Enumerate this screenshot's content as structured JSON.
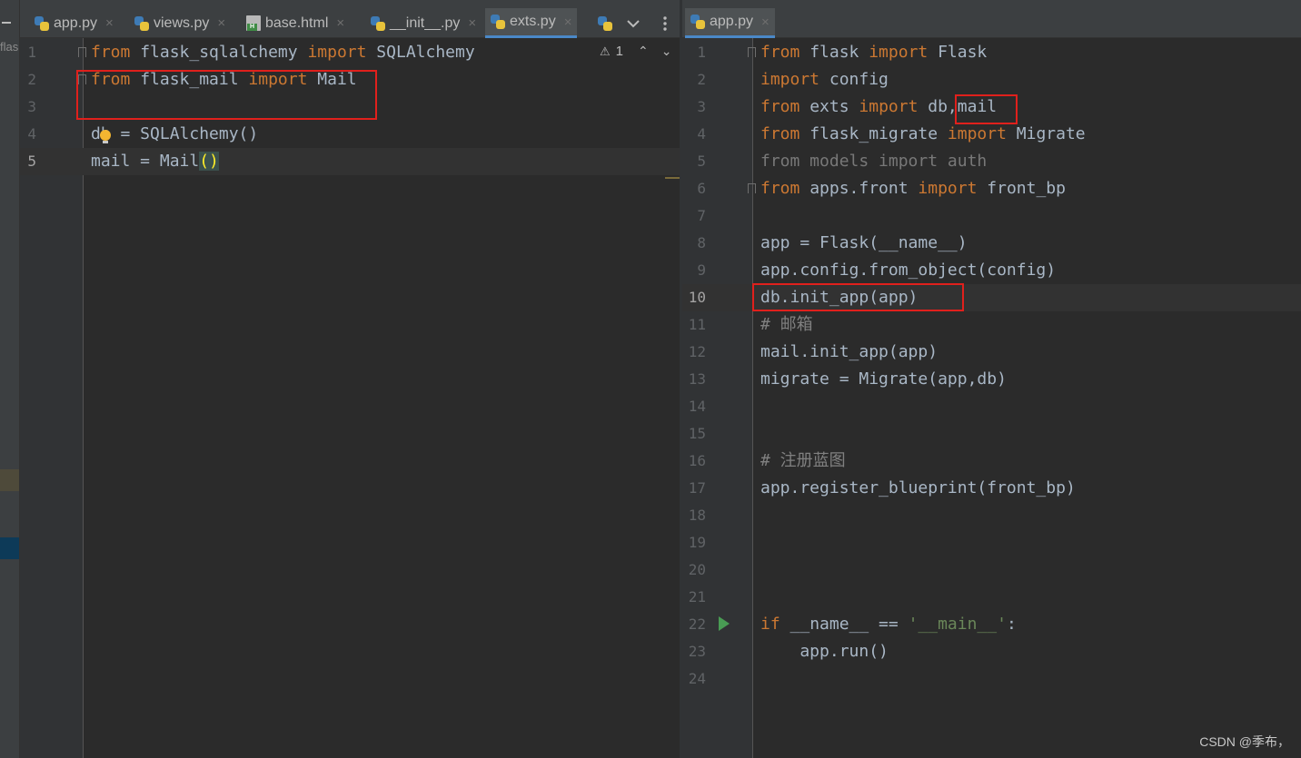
{
  "left_strip": {
    "project_label": "flas"
  },
  "left_pane": {
    "tabs": [
      {
        "label": "app.py",
        "icon": "python-file-icon",
        "active": false
      },
      {
        "label": "views.py",
        "icon": "python-file-icon",
        "active": false
      },
      {
        "label": "base.html",
        "icon": "html-file-icon",
        "active": false
      },
      {
        "label": "__init__.py",
        "icon": "python-file-icon",
        "active": false
      },
      {
        "label": "exts.py",
        "icon": "python-file-icon",
        "active": true
      }
    ],
    "close_glyph": "×",
    "inspection": {
      "warning_count": "1",
      "warning_glyph": "⚠",
      "up_glyph": "⌃",
      "down_glyph": "⌄"
    },
    "line_numbers": [
      "1",
      "2",
      "3",
      "4",
      "5"
    ],
    "lines": [
      [
        "from",
        " flask_sqlalchemy ",
        "import",
        " SQLAlchemy"
      ],
      [
        "from",
        " flask_mail ",
        "import",
        " Mail"
      ],
      [],
      [
        "db = SQLAlchemy()"
      ],
      [
        "mail = Mail",
        "()"
      ]
    ]
  },
  "right_pane": {
    "tabs": [
      {
        "label": "app.py",
        "icon": "python-file-icon",
        "active": true
      }
    ],
    "line_numbers": [
      "1",
      "2",
      "3",
      "4",
      "5",
      "6",
      "7",
      "8",
      "9",
      "10",
      "11",
      "12",
      "13",
      "14",
      "15",
      "16",
      "17",
      "18",
      "19",
      "20",
      "21",
      "22",
      "23",
      "24"
    ],
    "lines": {
      "l1": [
        "from",
        " flask ",
        "import",
        " Flask"
      ],
      "l2": [
        "import",
        " config"
      ],
      "l3": [
        "from",
        " exts ",
        "import",
        " db,mail"
      ],
      "l4": [
        "from",
        " flask_migrate ",
        "import",
        " Migrate"
      ],
      "l5": "from models import auth",
      "l6": [
        "from",
        " apps.front ",
        "import",
        " front_bp"
      ],
      "l8": "app = Flask(__name__)",
      "l9": "app.config.from_object(config)",
      "l10": "db.init_app(app)",
      "l11": "# 邮箱",
      "l12": "mail.init_app(app)",
      "l13": "migrate = Migrate(app,db)",
      "l16": "# 注册蓝图",
      "l17": "app.register_blueprint(front_bp)",
      "l22": [
        "if",
        " __name__ == ",
        "'__main__'",
        ":"
      ],
      "l23": "    app.run()"
    }
  },
  "watermark": "CSDN @季布，",
  "colors": {
    "keyword": "#cc7832",
    "comment": "#808080",
    "string": "#6a8759",
    "highlight_box": "#e0201c",
    "active_tab_underline": "#4a88c7"
  }
}
